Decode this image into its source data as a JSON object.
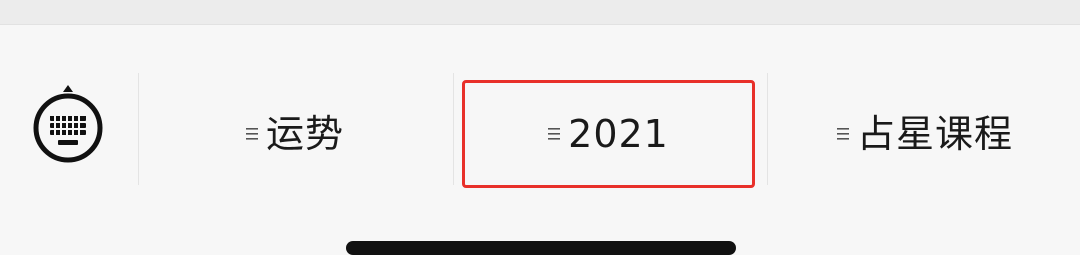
{
  "keyboard_toggle": {
    "icon": "keyboard-icon"
  },
  "menu": {
    "items": [
      {
        "label": "运势",
        "icon": "list-icon",
        "selected": false
      },
      {
        "label": "2021",
        "icon": "list-icon",
        "selected": true
      },
      {
        "label": "占星课程",
        "icon": "list-icon",
        "selected": false
      }
    ]
  },
  "colors": {
    "background": "#f7f7f7",
    "text": "#1a1a1a",
    "selection_outline": "#e8302a"
  }
}
